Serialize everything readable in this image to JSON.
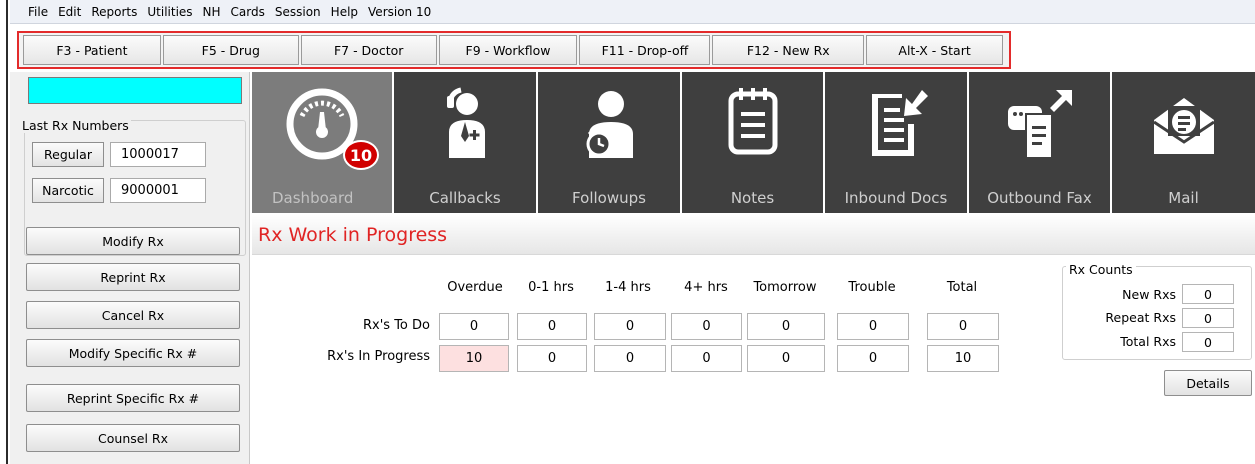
{
  "menu": [
    "File",
    "Edit",
    "Reports",
    "Utilities",
    "NH",
    "Cards",
    "Session",
    "Help",
    "Version 10"
  ],
  "toolbar": [
    "F3 - Patient",
    "F5 - Drug",
    "F7 - Doctor",
    "F9 - Workflow",
    "F11 - Drop-off",
    "F12 - New Rx",
    "Alt-X - Start"
  ],
  "last_rx": {
    "title": "Last Rx Numbers",
    "regular_label": "Regular",
    "regular_value": "1000017",
    "narcotic_label": "Narcotic",
    "narcotic_value": "9000001"
  },
  "side_buttons": [
    "Modify Rx",
    "Reprint Rx",
    "Cancel Rx",
    "Modify Specific Rx #",
    "Reprint Specific Rx #",
    "Counsel Rx"
  ],
  "tiles": [
    {
      "label": "Dashboard",
      "icon": "dashboard-gauge-icon",
      "badge": "10"
    },
    {
      "label": "Callbacks",
      "icon": "doctor-phone-icon"
    },
    {
      "label": "Followups",
      "icon": "person-alarm-icon"
    },
    {
      "label": "Notes",
      "icon": "notepad-icon"
    },
    {
      "label": "Inbound Docs",
      "icon": "inbound-document-icon"
    },
    {
      "label": "Outbound Fax",
      "icon": "fax-outbound-icon"
    },
    {
      "label": "Mail",
      "icon": "mail-envelope-icon"
    }
  ],
  "wip": {
    "title": "Rx Work in Progress",
    "columns": [
      "Overdue",
      "0-1 hrs",
      "1-4 hrs",
      "4+ hrs",
      "Tomorrow",
      "Trouble",
      "Total"
    ],
    "rows": [
      {
        "label": "Rx's To Do",
        "values": [
          "0",
          "0",
          "0",
          "0",
          "0",
          "0",
          "0"
        ]
      },
      {
        "label": "Rx's In Progress",
        "values": [
          "10",
          "0",
          "0",
          "0",
          "0",
          "0",
          "10"
        ]
      }
    ]
  },
  "rx_counts": {
    "title": "Rx Counts",
    "items": [
      {
        "label": "New Rxs",
        "value": "0"
      },
      {
        "label": "Repeat Rxs",
        "value": "0"
      },
      {
        "label": "Total Rxs",
        "value": "0"
      }
    ],
    "details_label": "Details"
  },
  "colors": {
    "alert_cell": "#fde0e0",
    "title_red": "#e02424",
    "toolbar_outline": "#e32b2b",
    "cyan_field": "#00ffff",
    "tile_bg": "#3f3f3f",
    "tile_active": "#7c7c7c",
    "badge": "#d10000"
  }
}
